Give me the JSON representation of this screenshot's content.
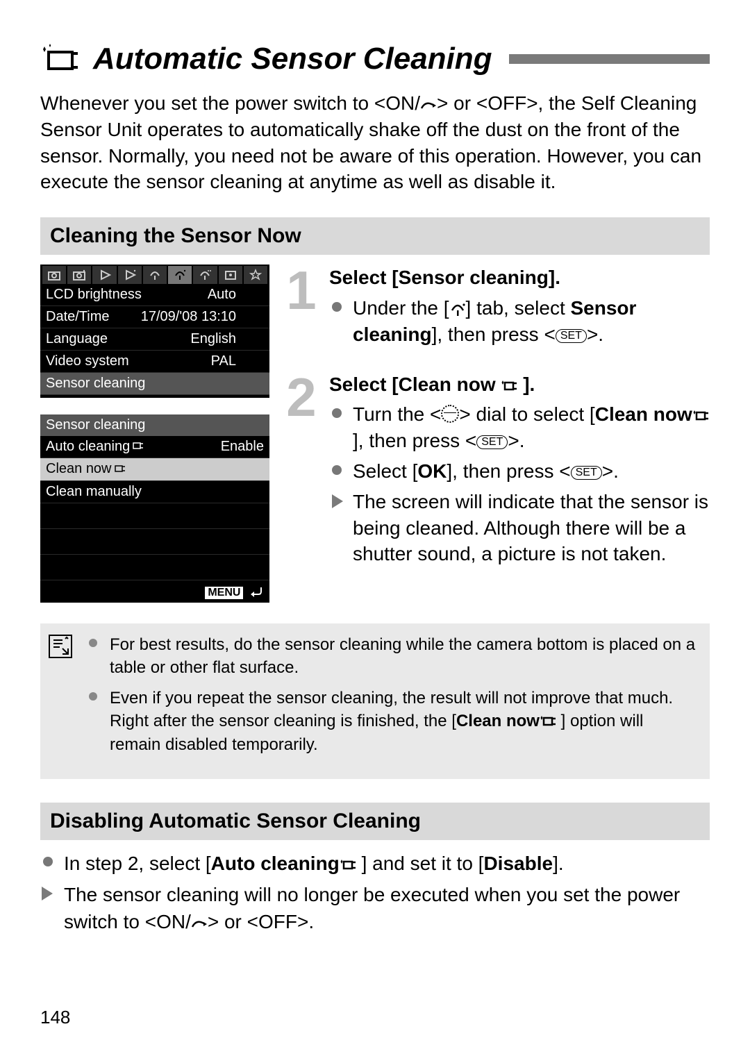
{
  "title": "Automatic Sensor Cleaning",
  "intro_parts": {
    "a": "Whenever you set the power switch to <",
    "on": "ON",
    "slash": "/",
    "b": "> or <",
    "off": "OFF",
    "c": ">, the Self Cleaning Sensor Unit operates to automatically shake off the dust on the front of the sensor. Normally, you need not be aware of this operation. However, you can execute the sensor cleaning at anytime as well as disable it."
  },
  "sub1": "Cleaning the Sensor Now",
  "lcd1": {
    "rows": [
      {
        "k": "LCD brightness",
        "v": "Auto"
      },
      {
        "k": "Date/Time",
        "v": "17/09/'08 13:10"
      },
      {
        "k": "Language",
        "v": "English"
      },
      {
        "k": "Video system",
        "v": "PAL"
      },
      {
        "k": "Sensor cleaning",
        "v": "",
        "hl": true
      }
    ]
  },
  "lcd2": {
    "header": "Sensor cleaning",
    "rows": [
      {
        "k": "Auto cleaning",
        "v": "Enable",
        "icon": true
      },
      {
        "k": "Clean now",
        "v": "",
        "icon": true,
        "sel": true
      },
      {
        "k": "Clean manually",
        "v": ""
      }
    ],
    "menu": "MENU"
  },
  "step1": {
    "num": "1",
    "title": "Select [Sensor cleaning].",
    "li1_a": "Under the [",
    "li1_b": "] tab, select ",
    "li1_bold": "Sensor cleaning",
    "li1_c": "], then press <",
    "li1_d": ">.",
    "set": "SET"
  },
  "step2": {
    "num": "2",
    "title_a": "Select [Clean now",
    "title_b": " ].",
    "li1_a": "Turn the <",
    "li1_b": "> dial to select [",
    "li1_bold": "Clean now",
    "li1_c": " ], then press <",
    "li1_d": ">.",
    "li2_a": "Select [",
    "li2_ok": "OK",
    "li2_b": "], then press <",
    "li2_c": ">.",
    "li3": "The screen will indicate that the sensor is being cleaned. Although there will be a shutter sound, a picture is not taken.",
    "set": "SET"
  },
  "notes": {
    "n1": "For best results, do the sensor cleaning while the camera bottom is placed on a table or other flat surface.",
    "n2_a": "Even if you repeat the sensor cleaning, the result will not improve that much. Right after the sensor cleaning is finished, the [",
    "n2_bold": "Clean now",
    "n2_b": " ] option will remain disabled temporarily."
  },
  "sub2": "Disabling Automatic Sensor Cleaning",
  "disable": {
    "d1_a": "In step 2, select [",
    "d1_bold": "Auto cleaning",
    "d1_b": " ] and set it to [",
    "d1_bold2": "Disable",
    "d1_c": "].",
    "d2_a": "The sensor cleaning will no longer be executed when you set the power switch to <",
    "d2_on": "ON",
    "d2_b": "> or <",
    "d2_off": "OFF",
    "d2_c": ">."
  },
  "page": "148"
}
